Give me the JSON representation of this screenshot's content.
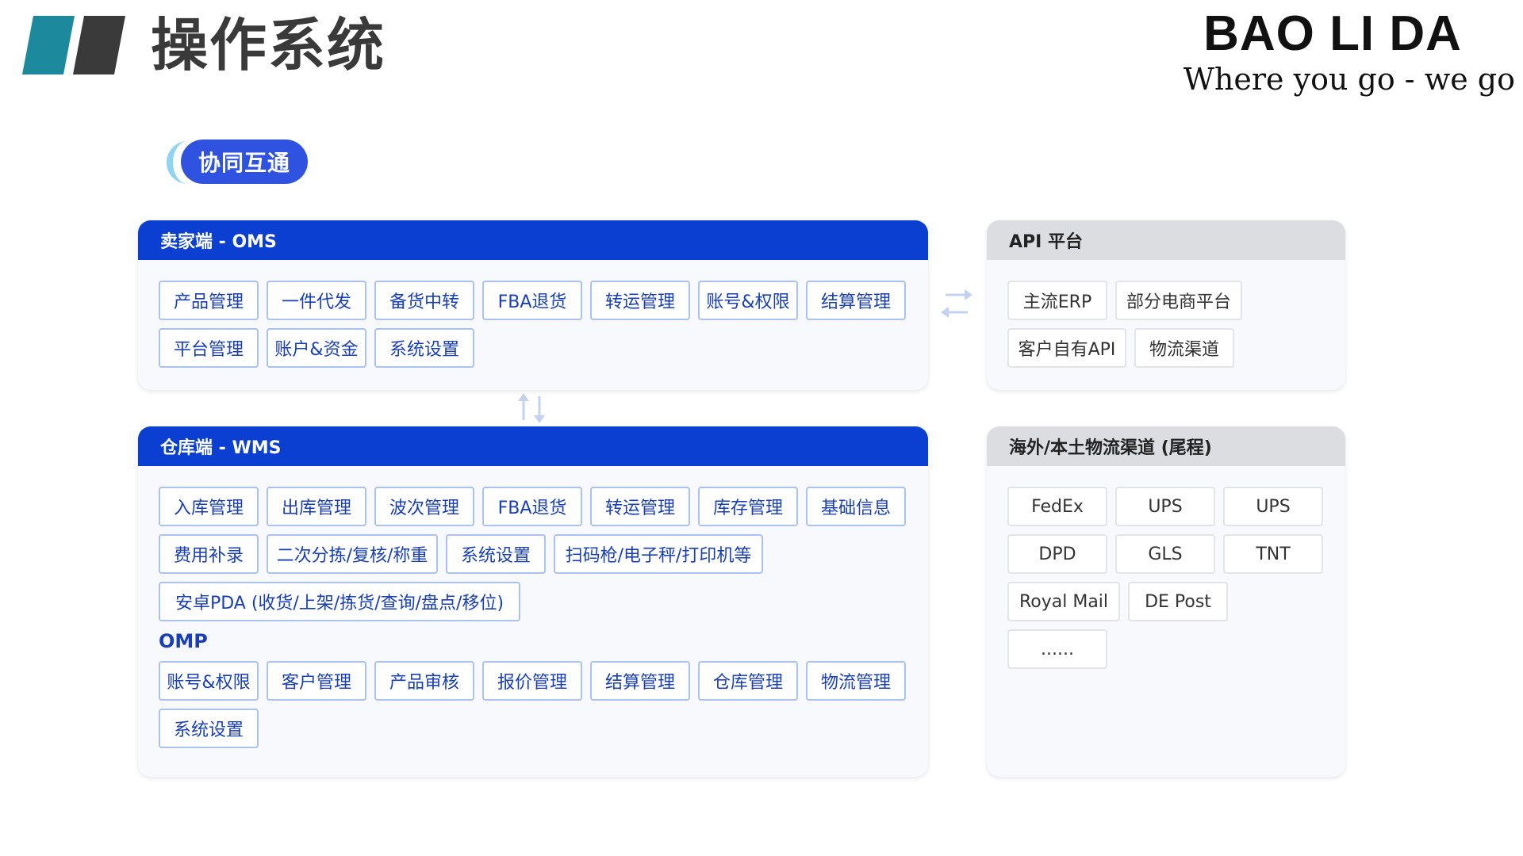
{
  "header": {
    "title": "操作系统",
    "brand_name": "BAO LI DA",
    "brand_slogan": "Where you go - we go",
    "colors": {
      "bar1": "#1c8a9c",
      "bar2": "#3a3a3a"
    }
  },
  "pill": {
    "label": "协同互通",
    "color": "#2f52e0"
  },
  "oms": {
    "title": "卖家端 - OMS",
    "rows": [
      [
        "产品管理",
        "一件代发",
        "备货中转",
        "FBA退货",
        "转运管理",
        "账号&权限",
        "结算管理"
      ],
      [
        "平台管理",
        "账户&资金",
        "系统设置"
      ]
    ]
  },
  "wms": {
    "title": "仓库端 - WMS",
    "rows": [
      [
        "入库管理",
        "出库管理",
        "波次管理",
        "FBA退货",
        "转运管理",
        "库存管理",
        "基础信息"
      ],
      [
        "费用补录",
        "二次分拣/复核/称重",
        "系统设置",
        "扫码枪/电子秤/打印机等"
      ],
      [
        "安卓PDA (收货/上架/拣货/查询/盘点/移位)"
      ]
    ],
    "omp_label": "OMP",
    "omp_rows": [
      [
        "账号&权限",
        "客户管理",
        "产品审核",
        "报价管理",
        "结算管理",
        "仓库管理",
        "物流管理"
      ],
      [
        "系统设置"
      ]
    ]
  },
  "api": {
    "title": "API 平台",
    "rows": [
      [
        "主流ERP",
        "部分电商平台"
      ],
      [
        "客户自有API",
        "物流渠道"
      ]
    ]
  },
  "logistics": {
    "title": "海外/本土物流渠道 (尾程)",
    "rows": [
      [
        "FedEx",
        "UPS",
        "UPS"
      ],
      [
        "DPD",
        "GLS",
        "TNT"
      ],
      [
        "Royal Mail",
        "DE Post"
      ],
      [
        "......"
      ]
    ]
  },
  "icons": {
    "horizontal_arrows": "swap-horizontal-icon",
    "vertical_arrows": "swap-vertical-icon"
  },
  "colors": {
    "accent_blue": "#0a3fd2",
    "chip_border": "#a9c3ee",
    "chip_text": "#1a3fb5",
    "gray_header": "#dcdde1"
  }
}
